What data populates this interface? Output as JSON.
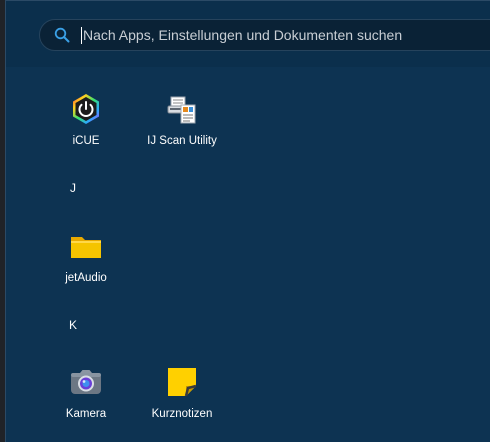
{
  "search": {
    "placeholder": "Nach Apps, Einstellungen und Dokumenten suchen"
  },
  "groups": [
    {
      "letter": "",
      "apps": [
        {
          "label": "iCUE",
          "icon": "icue-icon"
        },
        {
          "label": "IJ Scan Utility",
          "icon": "scanner-icon"
        }
      ]
    },
    {
      "letter": "J",
      "apps": [
        {
          "label": "jetAudio",
          "icon": "folder-icon"
        }
      ]
    },
    {
      "letter": "K",
      "apps": [
        {
          "label": "Kamera",
          "icon": "camera-icon"
        },
        {
          "label": "Kurznotizen",
          "icon": "sticky-notes-icon"
        }
      ]
    }
  ],
  "colors": {
    "panel": "#0d3352",
    "folder": "#f5c400",
    "sticky": "#ffd000"
  }
}
